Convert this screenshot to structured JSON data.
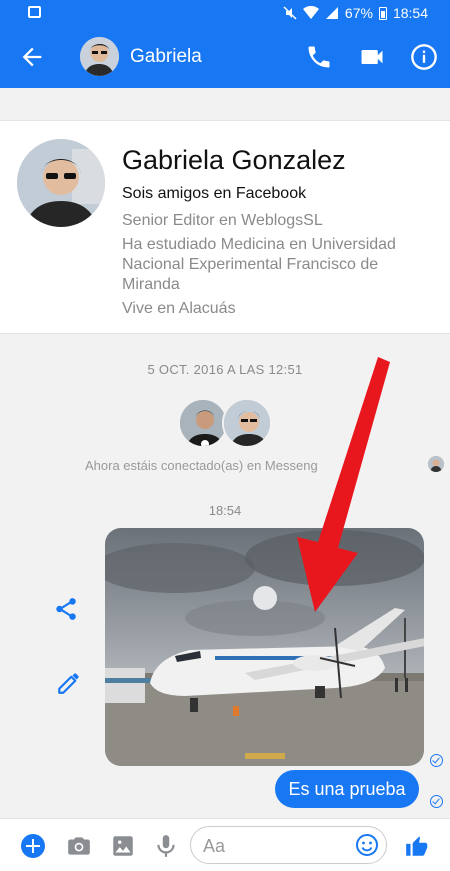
{
  "status_bar": {
    "battery": "67%",
    "time": "18:54"
  },
  "app_bar": {
    "contact_name": "Gabriela"
  },
  "profile": {
    "full_name": "Gabriela Gonzalez",
    "relationship": "Sois amigos en Facebook",
    "job": "Senior Editor en WeblogsSL",
    "education": "Ha estudiado Medicina en Universidad Nacional Experimental Francisco de Miranda",
    "location": "Vive en Alacuás"
  },
  "conversation": {
    "date_header": "5 OCT. 2016 A LAS 12:51",
    "connected_notice": "Ahora estáis conectado(as) en Messeng",
    "time_header": "18:54",
    "message_text": "Es una prueba"
  },
  "composer": {
    "placeholder": "Aa"
  },
  "colors": {
    "accent": "#1877f2",
    "annotation_arrow": "#e8171e"
  }
}
